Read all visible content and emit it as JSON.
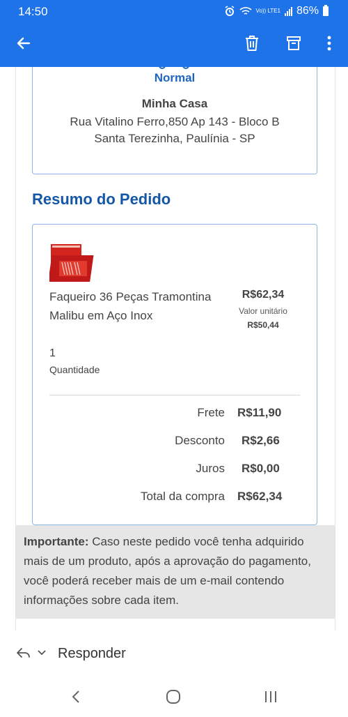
{
  "status_bar": {
    "time": "14:50",
    "network": "Vo)) LTE1",
    "battery": "86%"
  },
  "toolbar": {
    "back_icon": "arrow-left-icon",
    "delete_icon": "trash-icon",
    "archive_icon": "archive-icon",
    "more_icon": "more-vert-icon"
  },
  "address": {
    "shipping_type": "Normal",
    "name": "Minha Casa",
    "line1": "Rua Vitalino Ferro,850 Ap 143 - Bloco B",
    "line2": "Santa Terezinha, Paulínia - SP"
  },
  "summary": {
    "title": "Resumo do Pedido",
    "product": {
      "name": "Faqueiro 36 Peças Tramontina Malibu em Aço Inox",
      "price": "R$62,34",
      "unit_label": "Valor unitário",
      "unit_price": "R$50,44",
      "quantity": "1",
      "quantity_label": "Quantidade"
    },
    "rows": [
      {
        "label": "Frete",
        "value": "R$11,90"
      },
      {
        "label": "Desconto",
        "value": "R$2,66"
      },
      {
        "label": "Juros",
        "value": "R$0,00"
      },
      {
        "label": "Total da compra",
        "value": "R$62,34"
      }
    ]
  },
  "notice": {
    "bold": "Importante:",
    "text": " Caso neste pedido você tenha adquirido mais de um produto, após a aprovação do pagamento, você poderá receber mais de um e-mail contendo informações sobre cada item."
  },
  "reply": {
    "label": "Responder"
  },
  "colors": {
    "appbar": "#1e73e8",
    "accent_text": "#1557a7",
    "card_border": "#8bb6e4"
  }
}
